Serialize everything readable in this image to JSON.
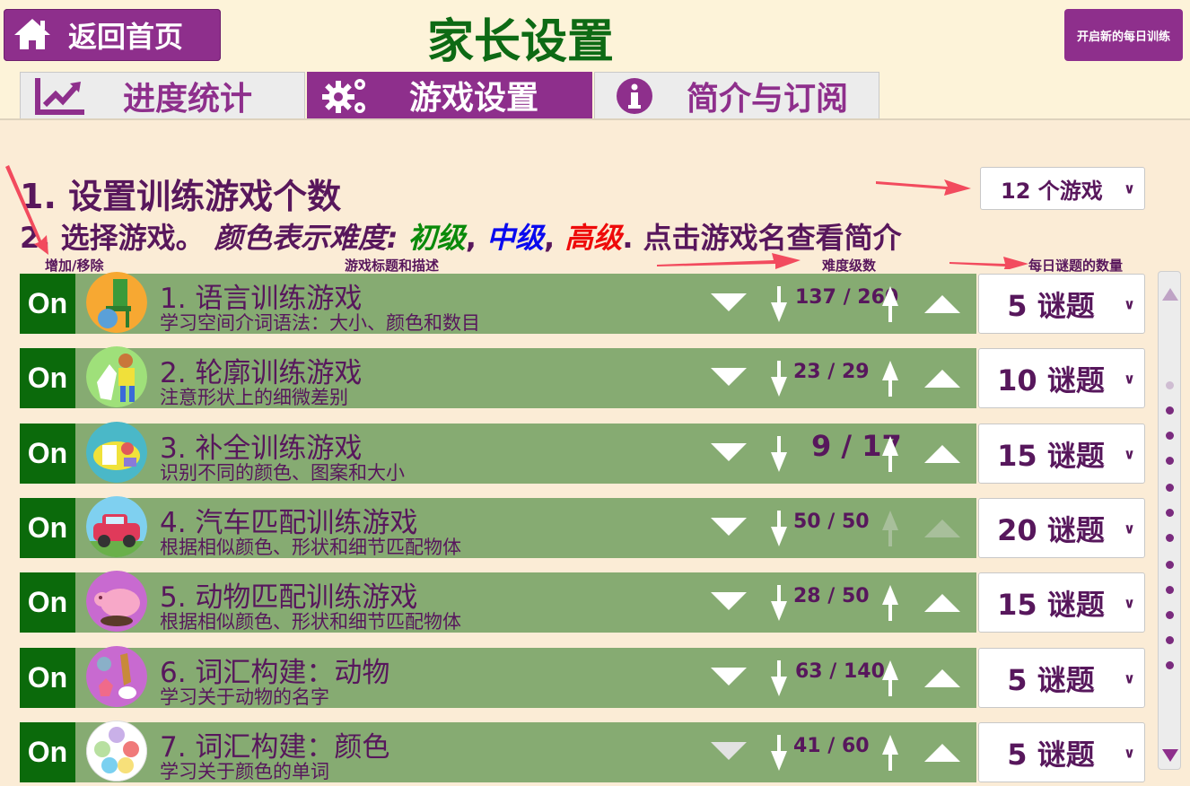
{
  "header": {
    "home_label": "返回首页",
    "title": "家长设置",
    "start_button_label": "开启新的每日训练"
  },
  "tabs": [
    {
      "label": "进度统计",
      "icon": "chart-line-icon",
      "active": false
    },
    {
      "label": "游戏设置",
      "icon": "gears-icon",
      "active": true
    },
    {
      "label": "简介与订阅",
      "icon": "info-icon",
      "active": false
    }
  ],
  "section1": {
    "heading": "1. 设置训练游戏个数",
    "games_count_value": "12 个游戏"
  },
  "section2": {
    "prefix": "2. 选择游戏。",
    "color_hint": "颜色表示难度:",
    "level_easy": "初级",
    "comma1": ",",
    "level_mid": "中级",
    "comma2": ",",
    "level_hard": "高级",
    "suffix": ". 点击游戏名查看简介"
  },
  "columns": {
    "add_remove": "增加/移除",
    "title_desc": "游戏标题和描述",
    "difficulty": "难度级数",
    "daily_count": "每日谜题的数量"
  },
  "games": [
    {
      "toggle": "On",
      "title": "1. 语言训练游戏",
      "desc": "学习空间介词语法：大小、颜色和数目",
      "progress": "137 / 260",
      "puzzles": "5 谜题",
      "icon": "chair-ball-icon"
    },
    {
      "toggle": "On",
      "title": "2. 轮廓训练游戏",
      "desc": "注意形状上的细微差别",
      "progress": "23 / 29",
      "puzzles": "10 谜题",
      "icon": "boy-silhouette-icon"
    },
    {
      "toggle": "On",
      "title": "3. 补全训练游戏",
      "desc": "识别不同的颜色、图案和大小",
      "progress": "9 / 17",
      "puzzles": "15 谜题",
      "icon": "fish-puzzle-icon"
    },
    {
      "toggle": "On",
      "title": "4. 汽车匹配训练游戏",
      "desc": "根据相似颜色、形状和细节匹配物体",
      "progress": "50 / 50",
      "puzzles": "20 谜题",
      "icon": "car-icon"
    },
    {
      "toggle": "On",
      "title": "5. 动物匹配训练游戏",
      "desc": "根据相似颜色、形状和细节匹配物体",
      "progress": "28 / 50",
      "puzzles": "15 谜题",
      "icon": "pig-icon"
    },
    {
      "toggle": "On",
      "title": "6. 词汇构建：动物",
      "desc": "学习关于动物的名字",
      "progress": "63 / 140",
      "puzzles": "5 谜题",
      "icon": "animals-icon"
    },
    {
      "toggle": "On",
      "title": "7. 词汇构建：颜色",
      "desc": "学习关于颜色的单词",
      "progress": "41 / 60",
      "puzzles": "5 谜题",
      "icon": "color-dots-icon"
    }
  ],
  "colors": {
    "brand_purple": "#8e2f8c",
    "title_green": "#0d6a14",
    "row_green": "#86ab72",
    "on_green": "#0b6a0b",
    "text_purple": "#57175c",
    "annotation_arrow": "#f24b5e"
  }
}
